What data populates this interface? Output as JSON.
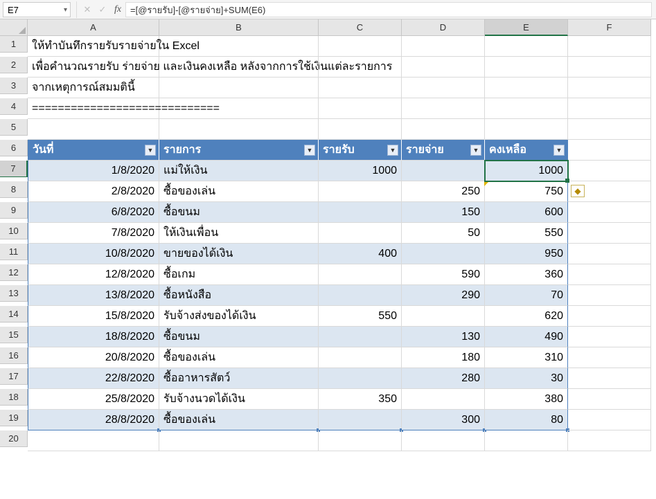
{
  "nameBox": "E7",
  "formula": "=[@รายรับ]-[@รายจ่าย]+SUM(E6)",
  "columns": [
    "A",
    "B",
    "C",
    "D",
    "E",
    "F"
  ],
  "textRows": {
    "1": "ให้ทำบันทึกรายรับรายจ่ายใน Excel",
    "2": "เพื่อคำนวณรายรับ ร่ายจ่าย และเงินคงเหลือ หลังจากการใช้เงินแต่ละรายการ",
    "3": "จากเหตุการณ์สมมตินี้",
    "4": "============================="
  },
  "tableHeaders": [
    "วันที่",
    "รายการ",
    "รายรับ",
    "รายจ่าย",
    "คงเหลือ"
  ],
  "rows": [
    {
      "n": 7,
      "date": "1/8/2020",
      "item": "แม่ให้เงิน",
      "in": "1000",
      "out": "",
      "bal": "1000"
    },
    {
      "n": 8,
      "date": "2/8/2020",
      "item": "ซื้อของเล่น",
      "in": "",
      "out": "250",
      "bal": "750"
    },
    {
      "n": 9,
      "date": "6/8/2020",
      "item": "ซื้อขนม",
      "in": "",
      "out": "150",
      "bal": "600"
    },
    {
      "n": 10,
      "date": "7/8/2020",
      "item": "ให้เงินเพื่อน",
      "in": "",
      "out": "50",
      "bal": "550"
    },
    {
      "n": 11,
      "date": "10/8/2020",
      "item": "ขายของได้เงิน",
      "in": "400",
      "out": "",
      "bal": "950"
    },
    {
      "n": 12,
      "date": "12/8/2020",
      "item": "ซื้อเกม",
      "in": "",
      "out": "590",
      "bal": "360"
    },
    {
      "n": 13,
      "date": "13/8/2020",
      "item": "ซื้อหนังสือ",
      "in": "",
      "out": "290",
      "bal": "70"
    },
    {
      "n": 14,
      "date": "15/8/2020",
      "item": "รับจ้างส่งของได้เงิน",
      "in": "550",
      "out": "",
      "bal": "620"
    },
    {
      "n": 15,
      "date": "18/8/2020",
      "item": "ซื้อขนม",
      "in": "",
      "out": "130",
      "bal": "490"
    },
    {
      "n": 16,
      "date": "20/8/2020",
      "item": "ซื้อของเล่น",
      "in": "",
      "out": "180",
      "bal": "310"
    },
    {
      "n": 17,
      "date": "22/8/2020",
      "item": "ซื้ออาหารสัตว์",
      "in": "",
      "out": "280",
      "bal": "30"
    },
    {
      "n": 18,
      "date": "25/8/2020",
      "item": "รับจ้างนวดได้เงิน",
      "in": "350",
      "out": "",
      "bal": "380"
    },
    {
      "n": 19,
      "date": "28/8/2020",
      "item": "ซื้อของเล่น",
      "in": "",
      "out": "300",
      "bal": "80"
    }
  ]
}
